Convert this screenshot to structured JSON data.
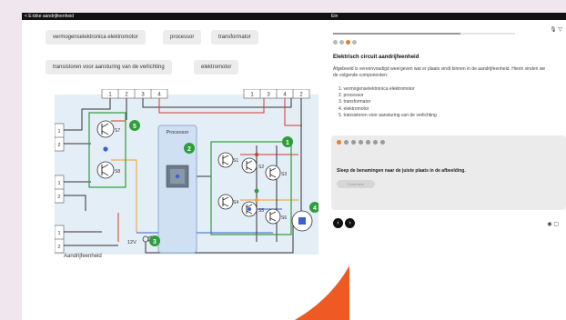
{
  "app": {
    "back_label": "< E-bike aandrijfeenheid",
    "top_right": "Ein"
  },
  "chips": [
    "vermogenselektronica elektromotor",
    "processor",
    "transformator",
    "transistoren voor aansturing van de verlichting",
    "elektromotor"
  ],
  "diagram": {
    "caption": "Aandrijfeenheid",
    "processor_label": "Processor",
    "voltage_label": "12V",
    "markers": [
      "1",
      "2",
      "3",
      "4",
      "5"
    ],
    "left_connector": [
      "1",
      "2",
      "3",
      "4"
    ],
    "right_connector": [
      "1",
      "3",
      "4",
      "2"
    ],
    "side_pins": [
      "1",
      "2",
      "1",
      "2",
      "1",
      "2"
    ],
    "transistors": [
      "S1",
      "S2",
      "S3",
      "S4",
      "S5",
      "S6",
      "S7",
      "S8"
    ]
  },
  "exercise": {
    "progress": 0.7,
    "step_count": 4,
    "active_step": 3,
    "title": "Elektrisch circuit aandrijfeenheid",
    "intro": "Afgebeeld is vereenvoudigd weergeven wat er plaats vindt binnen in de aandrijfeenheid. Hierin vinden we de volgende componenten:",
    "list": [
      "1. vermogenselektronica elektromotor",
      "2. processor",
      "3. transformator",
      "4. elektromotor",
      "5. transistoren voor aansturing van de verlichting"
    ],
    "card_dot_count": 7,
    "card_active": 1,
    "instruction": "Sleep de benamingen naar de juiste plaats in de afbeelding.",
    "check_label": "Controleer"
  },
  "nav": {
    "prev": "‹",
    "next": "›"
  },
  "icons": {
    "top": "mic-icon",
    "bottom": "eye-icon"
  },
  "colors": {
    "accent": "#ef7a2a",
    "marker": "#2e9d3b",
    "wire_red": "#d23a2a",
    "wire_blue": "#3a5fd2",
    "wire_orange": "#f0a020"
  }
}
